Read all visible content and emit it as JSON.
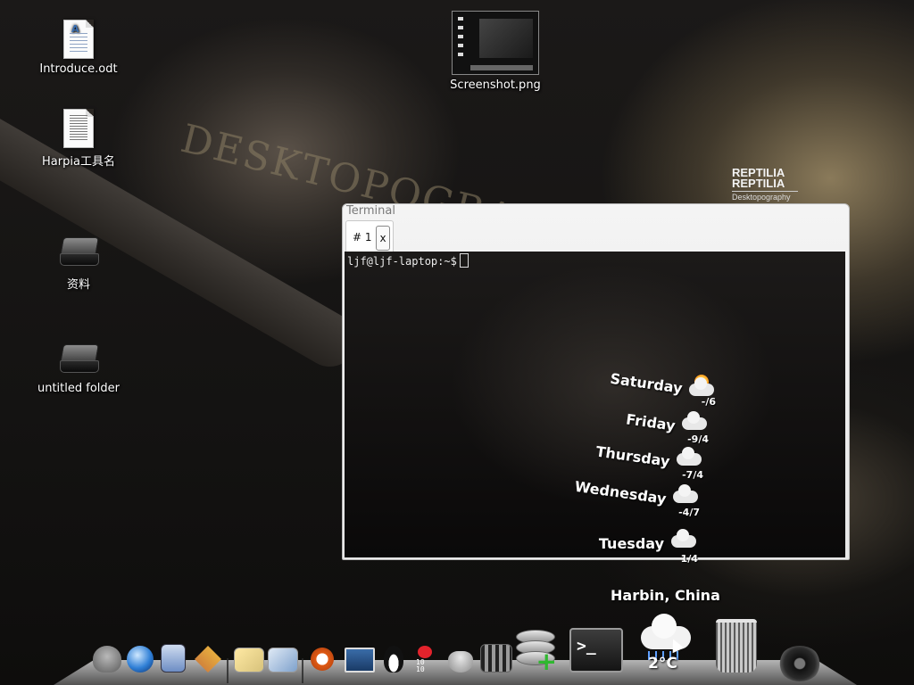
{
  "desktop": {
    "icons": [
      {
        "label": "Introduce.odt",
        "icon": "odt-document-icon"
      },
      {
        "label": "Harpia工具名",
        "icon": "text-document-icon"
      },
      {
        "label": "资料",
        "icon": "drive-icon"
      },
      {
        "label": "untitled folder",
        "icon": "drive-icon"
      },
      {
        "label": "Screenshot.png",
        "icon": "image-thumbnail-icon"
      }
    ]
  },
  "wallpaper": {
    "title": "DESKTOPOGRAPHY",
    "logo_line1": "REPTILIA",
    "logo_line2": "REPTILIA",
    "logo_line3": "Desktopography"
  },
  "terminal": {
    "window_title": "Terminal",
    "tab_label": "# 1",
    "tab_close": "x",
    "prompt": "ljf@ljf-laptop:~$"
  },
  "weather": {
    "location": "Harbin, China",
    "current_temp": "2°C",
    "forecast": [
      {
        "day": "Saturday",
        "temp": "-/6",
        "icon": "partly-sunny-icon"
      },
      {
        "day": "Friday",
        "temp": "-9/4",
        "icon": "cloudy-snow-icon"
      },
      {
        "day": "Thursday",
        "temp": "-7/4",
        "icon": "cloudy-snow-icon"
      },
      {
        "day": "Wednesday",
        "temp": "-4/7",
        "icon": "cloudy-rain-icon"
      },
      {
        "day": "Tuesday",
        "temp": "1/4",
        "icon": "cloudy-rain-icon"
      }
    ]
  },
  "dock": {
    "items": [
      "gimp-icon",
      "browser-icon",
      "mail-icon",
      "tools-icon",
      "photo-viewer-icon",
      "image-editor-icon",
      "ubuntu-icon",
      "monitor-icon",
      "tux-icon",
      "ruby-icon",
      "bowl-icon",
      "media-player-icon",
      "database-add-icon",
      "terminal-icon",
      "weather-icon",
      "trash-icon",
      "speaker-icon"
    ]
  }
}
